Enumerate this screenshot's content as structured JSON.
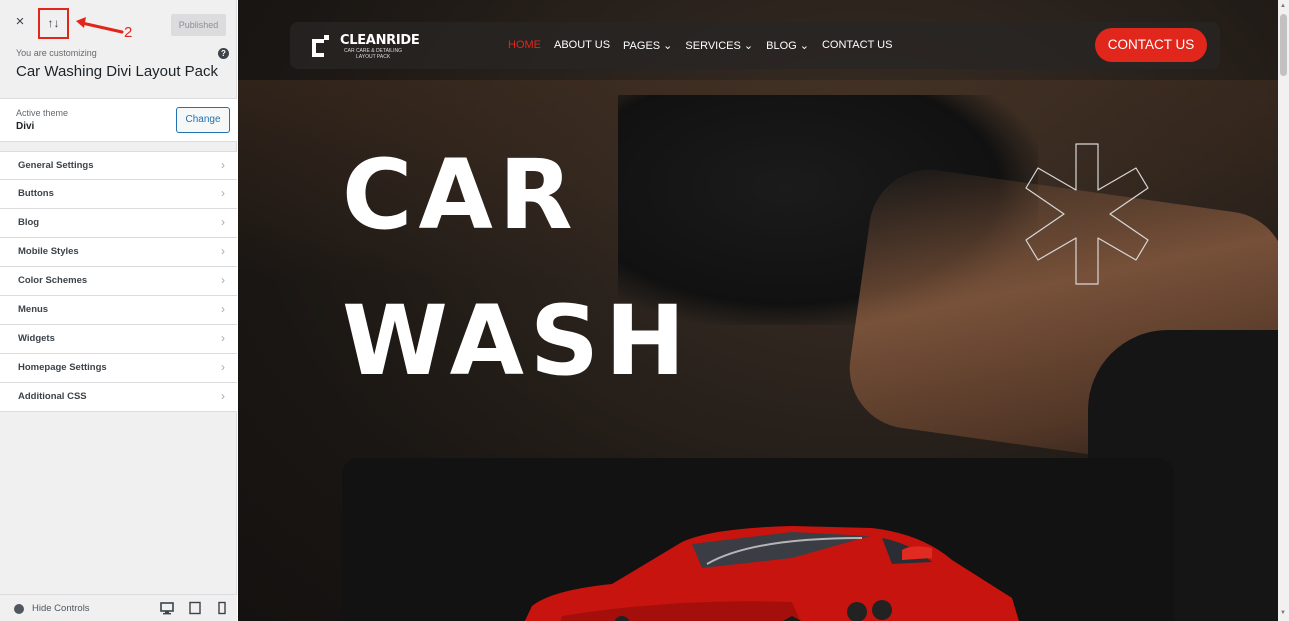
{
  "customizer": {
    "close_icon": "×",
    "toggle_icon": "↑↓",
    "annotation_number": "2",
    "publish_label": "Published",
    "customizing_label": "You are customizing",
    "help_icon": "?",
    "site_title": "Car Washing Divi Layout Pack",
    "theme": {
      "label": "Active theme",
      "name": "Divi",
      "change_label": "Change"
    },
    "menu": [
      {
        "label": "General Settings"
      },
      {
        "label": "Buttons"
      },
      {
        "label": "Blog"
      },
      {
        "label": "Mobile Styles"
      },
      {
        "label": "Color Schemes"
      },
      {
        "label": "Menus"
      },
      {
        "label": "Widgets"
      },
      {
        "label": "Homepage Settings"
      },
      {
        "label": "Additional CSS"
      }
    ],
    "chevron": "›",
    "footer": {
      "hide_label": "Hide Controls",
      "devices": [
        "desktop-icon",
        "tablet-icon",
        "mobile-icon"
      ]
    }
  },
  "preview": {
    "logo": {
      "name": "CLEANRIDE",
      "tagline_1": "CAR CARE & DETAILING",
      "tagline_2": "LAYOUT PACK"
    },
    "nav": [
      {
        "label": "HOME",
        "active": true
      },
      {
        "label": "ABOUT US"
      },
      {
        "label": "PAGES ⌄"
      },
      {
        "label": "SERVICES ⌄"
      },
      {
        "label": "BLOG ⌄"
      },
      {
        "label": "CONTACT US"
      }
    ],
    "cta_label": "CONTACT US",
    "hero": {
      "line1": "CAR",
      "line2": "WASH"
    }
  },
  "colors": {
    "accent": "#e1261c",
    "wp_blue": "#2271b1",
    "sidebar_bg": "#f0f0f1"
  }
}
